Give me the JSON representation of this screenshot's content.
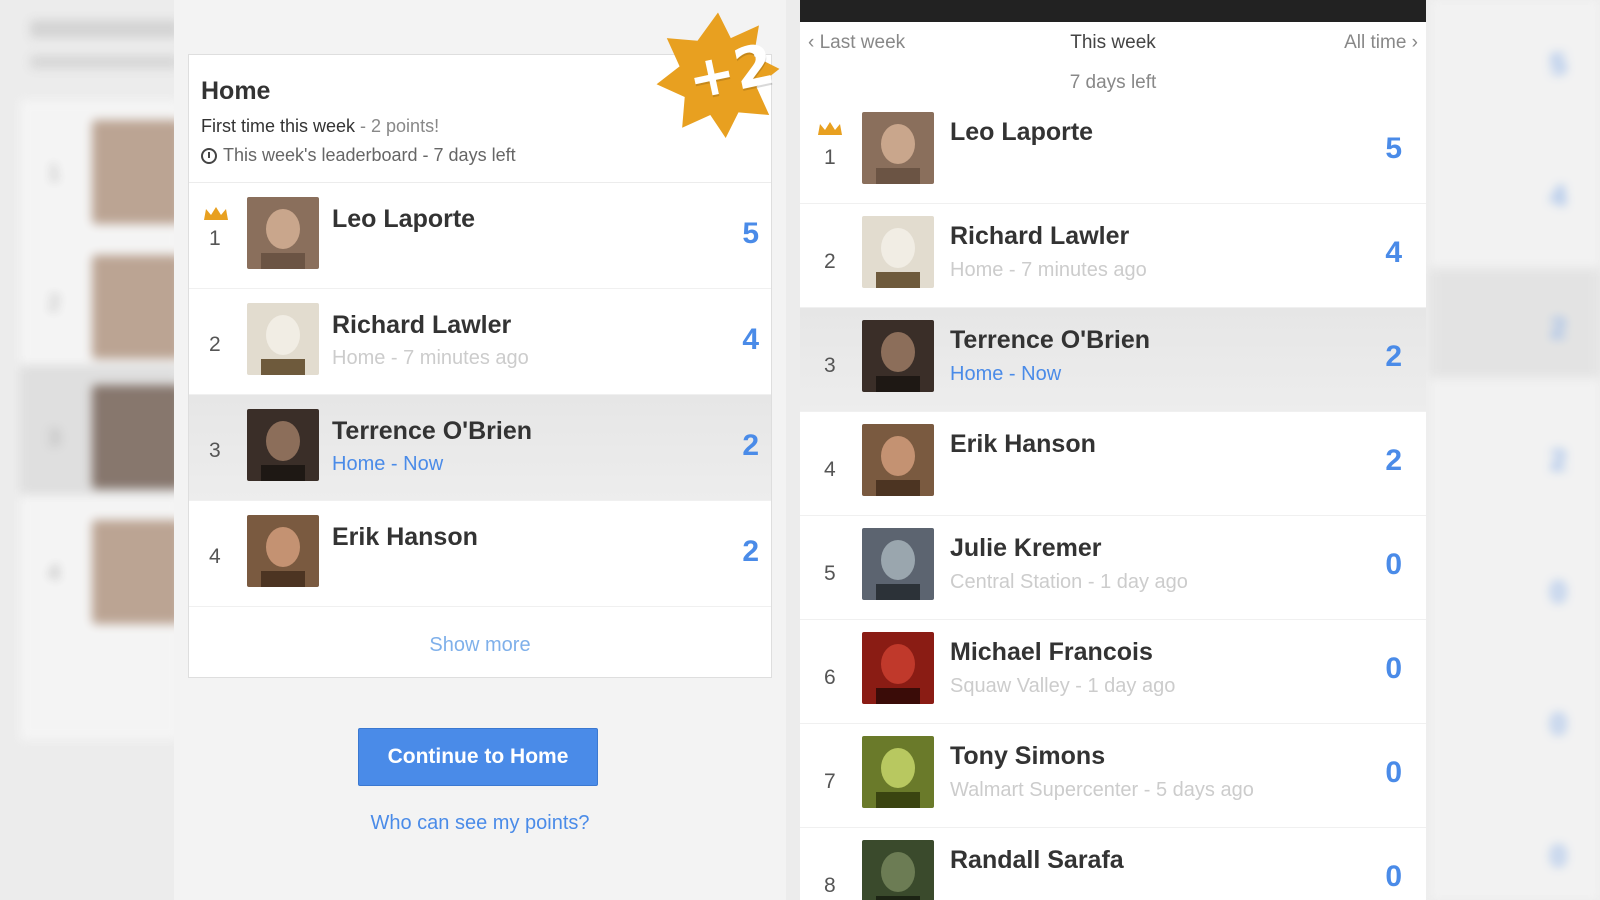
{
  "left_card": {
    "title": "Home",
    "subtitle_text": "First time this week",
    "subtitle_points": " - 2 points!",
    "leaderboard_note": "This week's leaderboard - 7 days left",
    "badge": "+2",
    "show_more": "Show more",
    "continue_button": "Continue to Home",
    "who_link": "Who can see my points?",
    "rows": [
      {
        "rank": "1",
        "name": "Leo Laporte",
        "meta": "",
        "score": "5",
        "crown": true,
        "active": false
      },
      {
        "rank": "2",
        "name": "Richard Lawler",
        "meta": "Home - 7 minutes ago",
        "score": "4",
        "crown": false,
        "active": false
      },
      {
        "rank": "3",
        "name": "Terrence O'Brien",
        "meta": "Home - Now",
        "score": "2",
        "crown": false,
        "active": true
      },
      {
        "rank": "4",
        "name": "Erik Hanson",
        "meta": "",
        "score": "2",
        "crown": false,
        "active": false
      }
    ]
  },
  "right_board": {
    "tab_prev": "‹ Last week",
    "tab_current": "This week",
    "tab_next": "All time ›",
    "days_left": "7 days left",
    "rows": [
      {
        "rank": "1",
        "name": "Leo Laporte",
        "meta": "",
        "score": "5",
        "crown": true,
        "active": false
      },
      {
        "rank": "2",
        "name": "Richard Lawler",
        "meta": "Home - 7 minutes ago",
        "score": "4",
        "crown": false,
        "active": false
      },
      {
        "rank": "3",
        "name": "Terrence O'Brien",
        "meta": "Home - Now",
        "score": "2",
        "crown": false,
        "active": true
      },
      {
        "rank": "4",
        "name": "Erik Hanson",
        "meta": "",
        "score": "2",
        "crown": false,
        "active": false
      },
      {
        "rank": "5",
        "name": "Julie Kremer",
        "meta": "Central Station - 1 day ago",
        "score": "0",
        "crown": false,
        "active": false
      },
      {
        "rank": "6",
        "name": "Michael Francois",
        "meta": "Squaw Valley - 1 day ago",
        "score": "0",
        "crown": false,
        "active": false
      },
      {
        "rank": "7",
        "name": "Tony Simons",
        "meta": "Walmart Supercenter - 5 days ago",
        "score": "0",
        "crown": false,
        "active": false
      },
      {
        "rank": "8",
        "name": "Randall Sarafa",
        "meta": "",
        "score": "0",
        "crown": false,
        "active": false
      }
    ]
  },
  "colors": {
    "accent": "#4a8be8",
    "badge": "#e8a020",
    "crown": "#e8a020"
  },
  "icons": {
    "crown": "crown-icon",
    "clock": "clock-icon",
    "badge": "star-burst-icon"
  }
}
